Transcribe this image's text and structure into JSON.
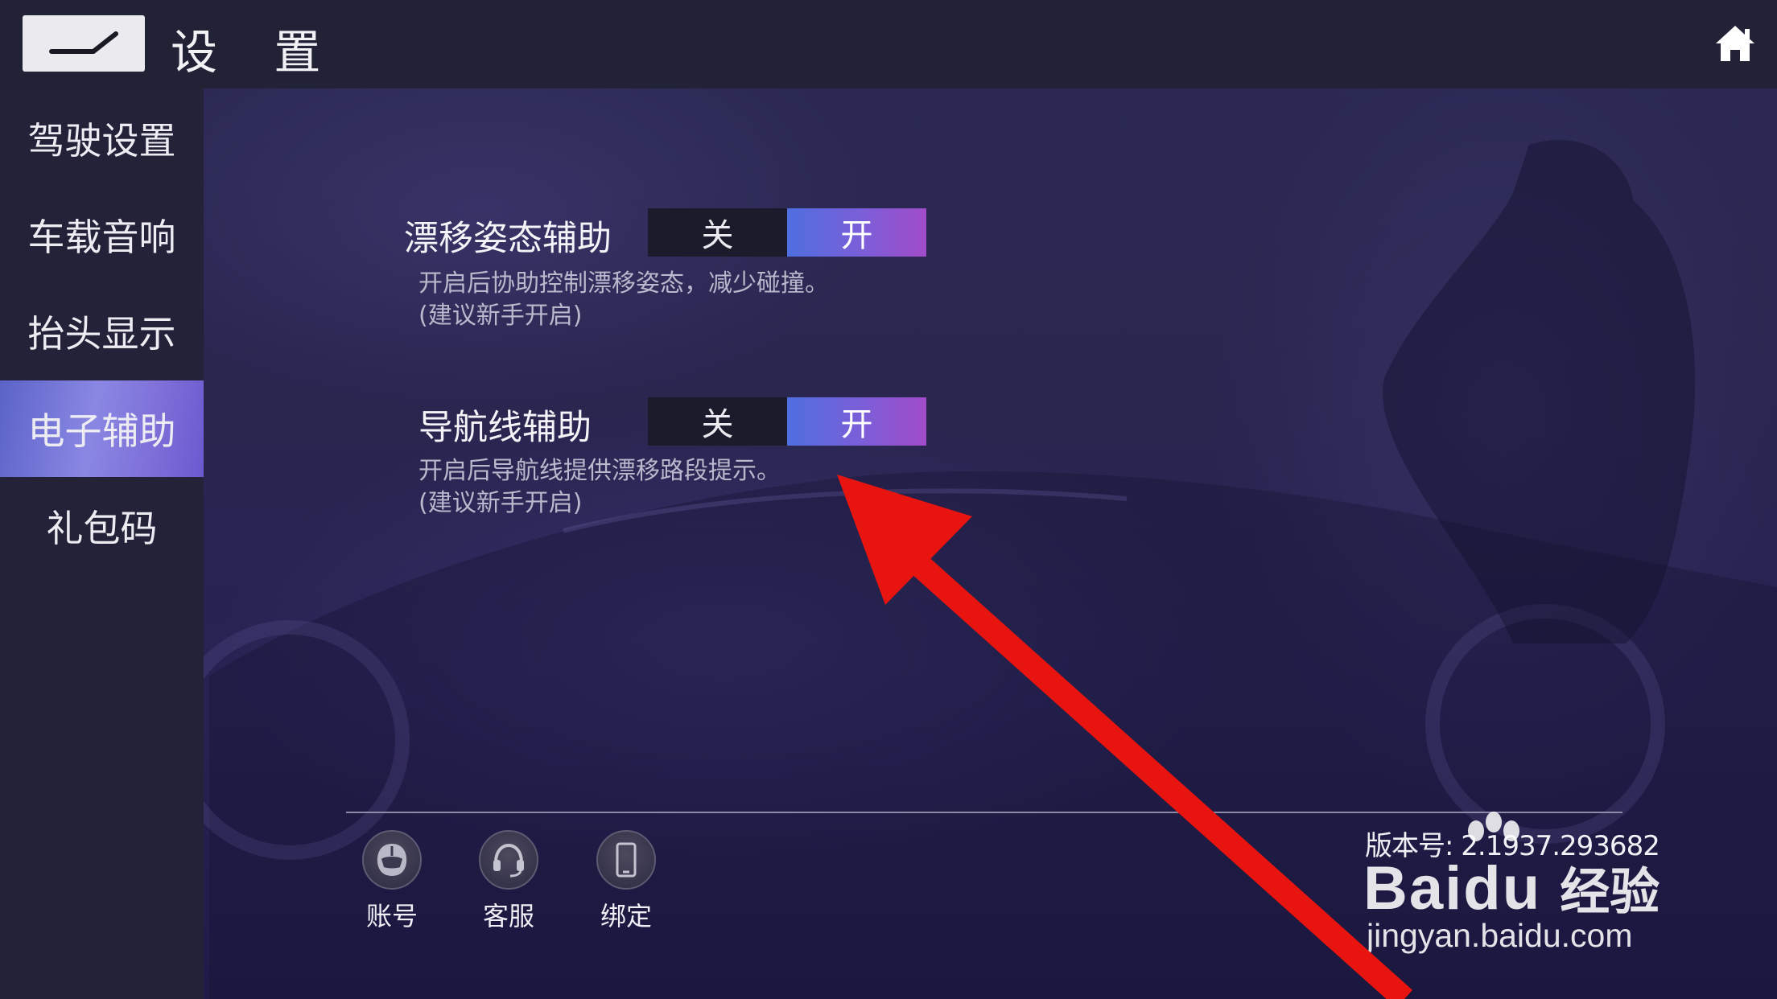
{
  "header": {
    "title": "设 置",
    "back_icon": "back-arrow-icon",
    "home_icon": "home-icon"
  },
  "sidebar": {
    "items": [
      {
        "label": "驾驶设置",
        "active": false
      },
      {
        "label": "车载音响",
        "active": false
      },
      {
        "label": "抬头显示",
        "active": false
      },
      {
        "label": "电子辅助",
        "active": true
      },
      {
        "label": "礼包码",
        "active": false
      }
    ]
  },
  "settings": [
    {
      "label": "漂移姿态辅助",
      "off_label": "关",
      "on_label": "开",
      "selected": "开",
      "desc_line1": "开启后协助控制漂移姿态，减少碰撞。",
      "desc_line2": "(建议新手开启)"
    },
    {
      "label": "导航线辅助",
      "off_label": "关",
      "on_label": "开",
      "selected": "开",
      "desc_line1": "开启后导航线提供漂移路段提示。",
      "desc_line2": "(建议新手开启)"
    }
  ],
  "bottom_bar": {
    "buttons": [
      {
        "label": "账号",
        "icon": "helmet-icon"
      },
      {
        "label": "客服",
        "icon": "headset-icon"
      },
      {
        "label": "绑定",
        "icon": "phone-icon"
      }
    ],
    "version_text": "版本号: 2.1937.293682"
  },
  "watermark": {
    "brand_latin": "Bai",
    "brand_latin2": "du",
    "brand_cn": "经验",
    "url": "jingyan.baidu.com"
  },
  "colors": {
    "accent_gradient_start": "#4f6fe0",
    "accent_gradient_end": "#a24cc8",
    "annotation_arrow": "#e8140f"
  }
}
